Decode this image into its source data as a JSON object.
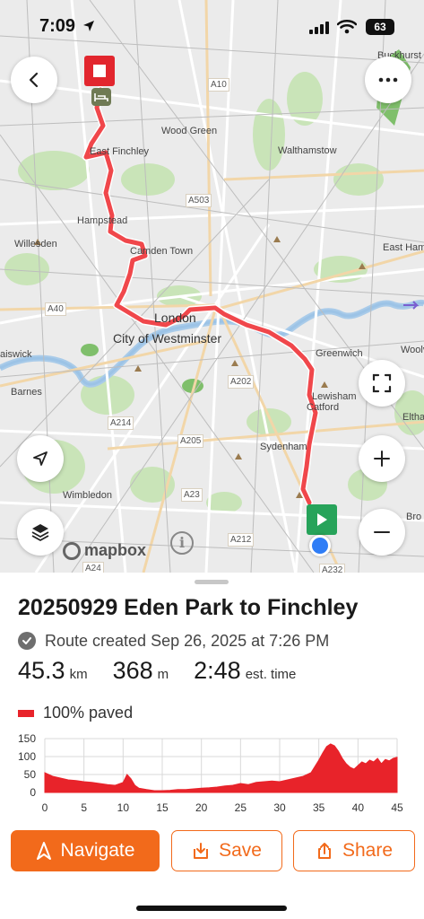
{
  "status": {
    "time": "7:09",
    "battery": "63"
  },
  "map": {
    "labels": {
      "wood_green": "Wood Green",
      "east_finchley": "East Finchley",
      "walthamstow": "Walthamstow",
      "hampstead": "Hampstead",
      "willesden": "Willesden",
      "camden_town": "Camden Town",
      "east_ham": "East Ham",
      "london": "London",
      "city_of_westminster": "City of Westminster",
      "greenwich": "Greenwich",
      "chiswick": "aiswick",
      "barnes": "Barnes",
      "lewisham": "Lewisham",
      "catford": "Catford",
      "eltham": "Eltha",
      "sydenham": "Sydenham",
      "wimbledon": "Wimbledon",
      "buckhurst": "Buckhurst",
      "woolwich": "Woolv",
      "bromley": "Bro"
    },
    "roads": [
      "A10",
      "A503",
      "A40",
      "A202",
      "A214",
      "A205",
      "A23",
      "A212",
      "A24",
      "A232"
    ],
    "attribution": "mapbox",
    "icons": {
      "back": "chevron-left-icon",
      "more": "more-horizontal-icon",
      "fullscreen": "expand-icon",
      "locate": "navigation-arrow-icon",
      "zoom_in": "plus-icon",
      "zoom_out": "minus-icon",
      "layers": "layers-icon",
      "info": "info-icon",
      "start": "play-icon",
      "end": "stop-icon",
      "lodging": "bed-icon"
    }
  },
  "route": {
    "title": "20250929 Eden Park to Finchley",
    "created": "Route created Sep 26, 2025 at 7:26 PM",
    "distance_value": "45.3",
    "distance_unit": "km",
    "elevation_value": "368",
    "elevation_unit": "m",
    "time_value": "2:48",
    "time_unit": "est. time",
    "paved": "100% paved"
  },
  "colors": {
    "accent": "#f26a1b",
    "route": "#e8232a",
    "start_pin": "#27a35a",
    "end_pin": "#e2262e",
    "current_location": "#2f7df6"
  },
  "chart_data": {
    "type": "area",
    "title": "",
    "xlabel": "",
    "ylabel": "",
    "xlim": [
      0,
      45
    ],
    "ylim": [
      0,
      150
    ],
    "x_ticks": [
      "0",
      "5",
      "10",
      "15",
      "20",
      "25",
      "30",
      "35",
      "40",
      "45"
    ],
    "y_ticks": [
      "0",
      "50",
      "100",
      "150"
    ],
    "grid": true,
    "series": [
      {
        "x": [
          0,
          1,
          2,
          3,
          4,
          5,
          6,
          7,
          8,
          9,
          10,
          10.5,
          11,
          11.5,
          12,
          13,
          14,
          15,
          16,
          17,
          18,
          19,
          20,
          21,
          22,
          23,
          24,
          25,
          26,
          27,
          28,
          29,
          30,
          31,
          32,
          33,
          34,
          35,
          35.5,
          36,
          36.5,
          37,
          37.5,
          38,
          38.5,
          39,
          39.5,
          40,
          40.5,
          41,
          41.5,
          42,
          42.5,
          43,
          43.5,
          44,
          44.5,
          45
        ],
        "y": [
          55,
          45,
          40,
          35,
          33,
          30,
          28,
          25,
          22,
          20,
          28,
          50,
          38,
          20,
          12,
          8,
          5,
          5,
          6,
          8,
          8,
          10,
          12,
          13,
          15,
          18,
          20,
          25,
          22,
          28,
          30,
          32,
          30,
          35,
          40,
          45,
          55,
          90,
          110,
          128,
          135,
          130,
          115,
          95,
          80,
          70,
          65,
          75,
          85,
          80,
          90,
          85,
          95,
          80,
          92,
          88,
          95,
          98
        ]
      }
    ]
  },
  "actions": {
    "navigate": "Navigate",
    "save": "Save",
    "share": "Share"
  }
}
